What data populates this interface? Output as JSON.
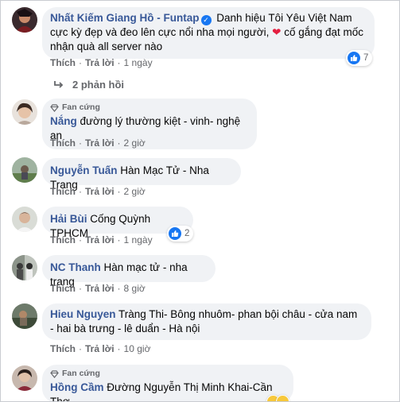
{
  "actions": {
    "like": "Thích",
    "reply": "Trả lời",
    "separator": "·"
  },
  "fan_badge": "Fan cứng",
  "comments": [
    {
      "author": "Nhất Kiếm Giang Hồ - Funtap",
      "text_before_heart": "Danh hiệu Tôi Yêu Việt Nam cực kỳ đẹp và đeo lên cực nổi nha mọi người,",
      "heart": "❤",
      "text_after_heart": "cố gắng đạt mốc nhận quà all server nào",
      "time": "1 ngày",
      "reactions": "7",
      "replies_label": "2 phản hồi"
    },
    {
      "author": "Nắng",
      "text": "đường lý thường kiệt - vinh- nghệ an",
      "time": "2 giờ"
    },
    {
      "author": "Nguyễn Tuấn",
      "text": "Hàn Mạc Tử - Nha Trang",
      "time": "2 giờ"
    },
    {
      "author": "Hải Bùi",
      "text": "Cống Quỳnh TPHCM",
      "time": "1 ngày",
      "reactions": "2"
    },
    {
      "author": "NC Thanh",
      "text": "Hàn mạc tử - nha trang",
      "time": "8 giờ"
    },
    {
      "author": "Hieu Nguyen",
      "text": "Tràng Thi- Bông nhuôm- phan bội châu - cửa nam - hai bà trưng - lê duẩn - Hà nội",
      "time": "10 giờ"
    },
    {
      "author": "Hồng Cầm",
      "text": "Đường Nguyễn Thị Minh Khai-Cần Thơ"
    }
  ],
  "colors": {
    "author": "#385898",
    "bubble": "#f0f2f5",
    "meta": "#65676b",
    "like_blue": "#1877f2",
    "heart_red": "#e41e3f"
  }
}
